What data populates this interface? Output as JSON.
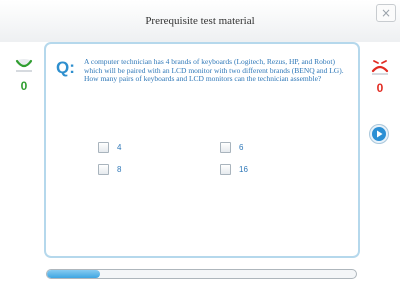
{
  "header": {
    "title": "Prerequisite test material",
    "close_label": "×"
  },
  "scores": {
    "correct": "0",
    "wrong": "0"
  },
  "question": {
    "label": "Q:",
    "text": "A computer technician has 4 brands of keyboards (Logitech, Rezus, HP, and Robot) which will be paired with an LCD monitor with two different brands (BENQ and LG). How many pairs of keyboards and LCD monitors can the technician assemble?"
  },
  "options": [
    "4",
    "6",
    "8",
    "16"
  ],
  "progress": {
    "fraction": 0.17
  },
  "icons": {
    "correct_face": "smiley-face-icon",
    "wrong_face": "sad-face-icon",
    "next": "play-arrow-icon"
  }
}
